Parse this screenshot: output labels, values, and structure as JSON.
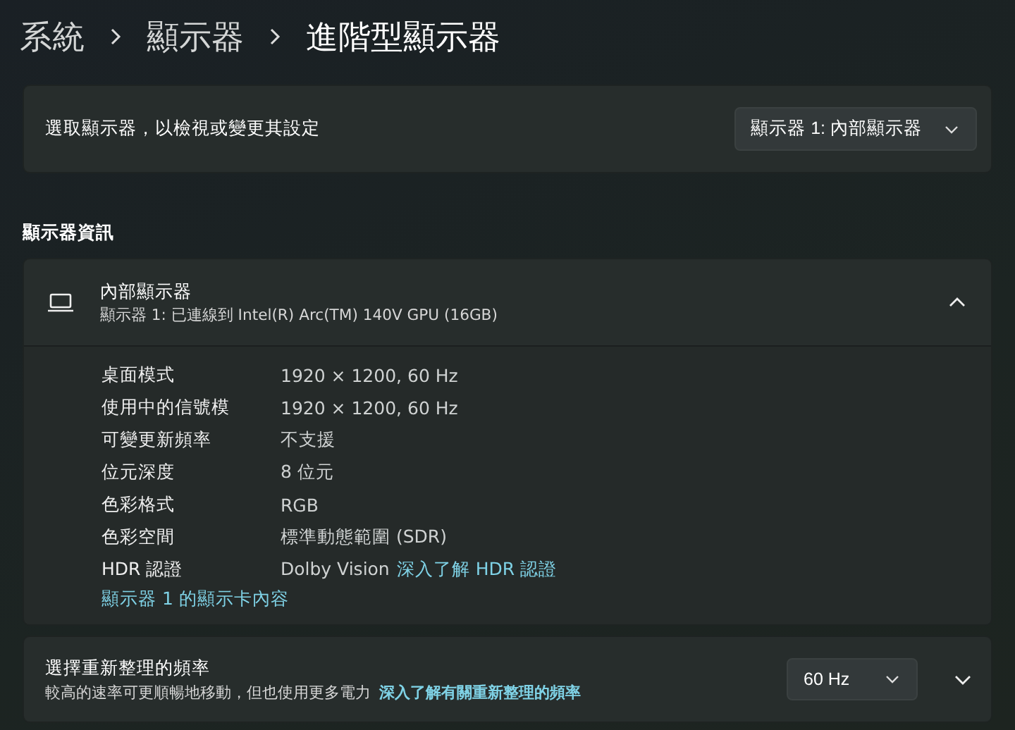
{
  "breadcrumb": [
    "系統",
    "顯示器",
    "進階型顯示器"
  ],
  "display_select": {
    "label": "選取顯示器，以檢視或變更其設定",
    "dropdown_value": "顯示器 1: 內部顯示器"
  },
  "section_heading": "顯示器資訊",
  "display_info": {
    "title": "內部顯示器",
    "subtitle": "顯示器 1: 已連線到 Intel(R) Arc(TM) 140V GPU (16GB)",
    "expanded": true,
    "rows": [
      {
        "label": "桌面模式",
        "value": "1920 × 1200, 60 Hz"
      },
      {
        "label": "使用中的信號模",
        "value": "1920 × 1200, 60 Hz"
      },
      {
        "label": "可變更新頻率",
        "value": "不支援"
      },
      {
        "label": "位元深度",
        "value": "8 位元"
      },
      {
        "label": "色彩格式",
        "value": "RGB"
      },
      {
        "label": "色彩空間",
        "value": "標準動態範圍 (SDR)"
      },
      {
        "label": "HDR 認證",
        "value": "Dolby Vision",
        "link": "深入了解 HDR 認證"
      }
    ],
    "adapter_link": "顯示器 1 的顯示卡內容"
  },
  "refresh_rate": {
    "title": "選擇重新整理的頻率",
    "description": "較高的速率可更順暢地移動，但也使用更多電力",
    "link": "深入了解有關重新整理的頻率",
    "dropdown_value": "60 Hz",
    "expanded": false
  }
}
